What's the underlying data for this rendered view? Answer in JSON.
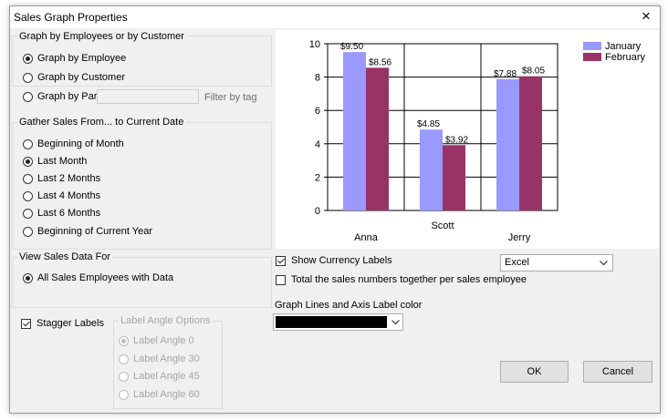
{
  "window": {
    "title": "Sales Graph Properties",
    "close_icon": "×"
  },
  "group_graph_by": {
    "label": "Graph by Employees or by Customer",
    "options": [
      {
        "label": "Graph by Employee",
        "selected": true
      },
      {
        "label": "Graph by Customer",
        "selected": false
      },
      {
        "label": "Graph by Part",
        "selected": false
      }
    ],
    "filter_input_value": "",
    "filter_label": "Filter by tag"
  },
  "group_gather": {
    "label": "Gather Sales From... to Current Date",
    "options": [
      {
        "label": "Beginning of Month",
        "selected": false
      },
      {
        "label": "Last Month",
        "selected": true
      },
      {
        "label": "Last 2 Months",
        "selected": false
      },
      {
        "label": "Last 4 Months",
        "selected": false
      },
      {
        "label": "Last 6 Months",
        "selected": false
      },
      {
        "label": "Beginning of Current Year",
        "selected": false
      }
    ]
  },
  "group_view": {
    "label": "View Sales Data For",
    "options": [
      {
        "label": "All Sales Employees with Data",
        "selected": true
      }
    ]
  },
  "stagger_labels": {
    "label": "Stagger Labels",
    "checked": true
  },
  "group_angle": {
    "label": "Label Angle Options",
    "options": [
      {
        "label": "Label Angle 0",
        "selected": true
      },
      {
        "label": "Label Angle 30",
        "selected": false
      },
      {
        "label": "Label Angle 45",
        "selected": false
      },
      {
        "label": "Label Angle 60",
        "selected": false
      }
    ]
  },
  "show_currency": {
    "label": "Show Currency Labels",
    "checked": true
  },
  "total_sales": {
    "label": "Total the sales numbers together per sales employee",
    "checked": false
  },
  "export_select": {
    "value": "Excel"
  },
  "color_label": "Graph Lines and Axis Label color",
  "color_value": "#000000",
  "buttons": {
    "ok": "OK",
    "cancel": "Cancel"
  },
  "colors": {
    "january": "#9999ff",
    "february": "#993366"
  },
  "chart_data": {
    "type": "bar",
    "categories": [
      "Anna",
      "Scott",
      "Jerry"
    ],
    "series": [
      {
        "name": "January",
        "values": [
          9.5,
          4.85,
          7.88
        ],
        "labels": [
          "$9.50",
          "$4.85",
          "$7.88"
        ]
      },
      {
        "name": "February",
        "values": [
          8.56,
          3.92,
          8.05
        ],
        "labels": [
          "$8.56",
          "$3.92",
          "$8.05"
        ]
      }
    ],
    "ylim": [
      0,
      10
    ],
    "yticks": [
      "0",
      "2",
      "4",
      "6",
      "8",
      "10"
    ],
    "grid": true,
    "legend": "top-right",
    "staggered_x_labels": true
  }
}
